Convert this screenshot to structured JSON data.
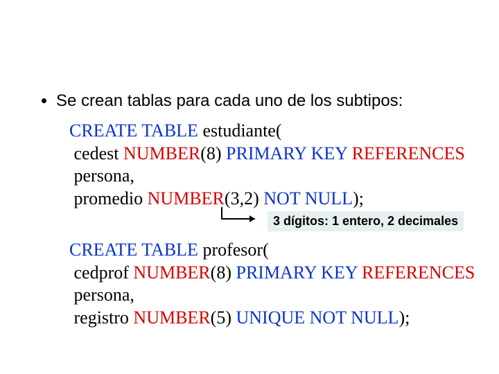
{
  "bullet": "Se crean tablas para cada uno de los subtipos:",
  "code1": {
    "l1a": "CREATE TABLE",
    "l1b": " estudiante(",
    "l2a": " cedest ",
    "l2b": "NUMBER",
    "l2c": "(8) ",
    "l2d": "PRIMARY KEY ",
    "l2e": "REFERENCES",
    "l3a": " persona",
    "l3b": ",",
    "l4a": " promedio ",
    "l4b": "NUMBER",
    "l4c": "(3,2) ",
    "l4d": "NOT NULL",
    "l4e": ");"
  },
  "annotation": "3 dígitos: 1 entero, 2 decimales",
  "code2": {
    "l1a": "CREATE TABLE",
    "l1b": " profesor(",
    "l2a": " cedprof ",
    "l2b": "NUMBER",
    "l2c": "(8) ",
    "l2d": "PRIMARY KEY ",
    "l2e": "REFERENCES",
    "l3a": " persona",
    "l3b": ",",
    "l4a": " registro ",
    "l4b": "NUMBER",
    "l4c": "(5) ",
    "l4d": "UNIQUE NOT NULL",
    "l4e": ");"
  }
}
